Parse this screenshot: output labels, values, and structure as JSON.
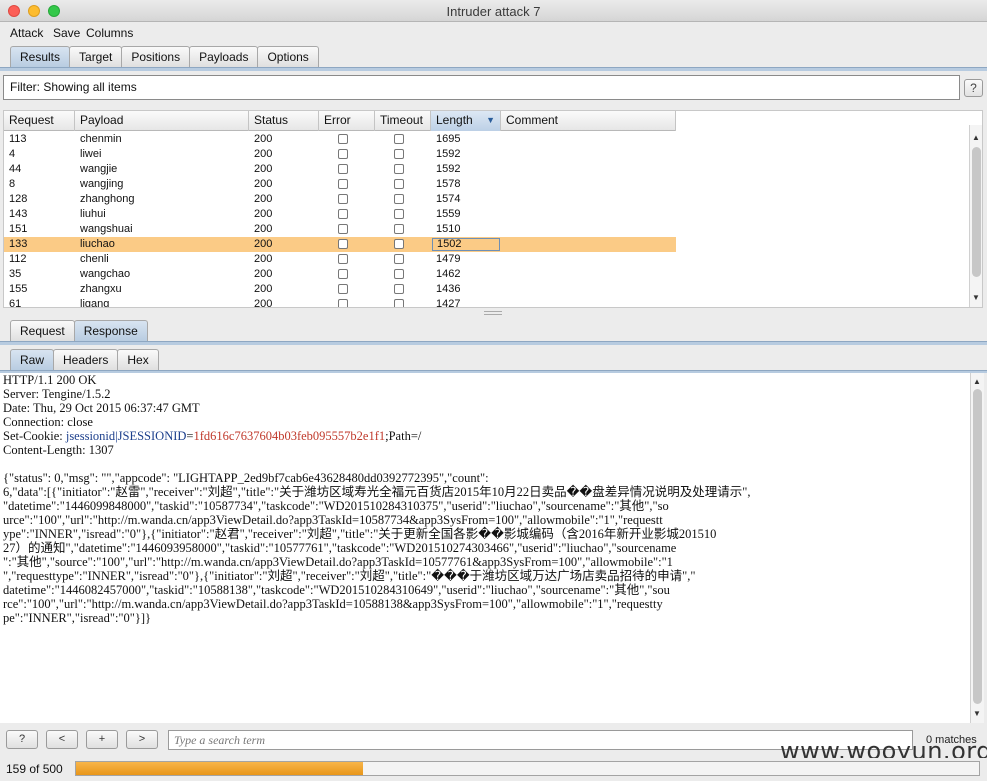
{
  "window": {
    "title": "Intruder attack 7"
  },
  "menu": [
    "Attack",
    "Save",
    "Columns"
  ],
  "main_tabs": [
    {
      "label": "Results",
      "active": true
    },
    {
      "label": "Target",
      "active": false
    },
    {
      "label": "Positions",
      "active": false
    },
    {
      "label": "Payloads",
      "active": false
    },
    {
      "label": "Options",
      "active": false
    }
  ],
  "filter": {
    "text": "Filter: Showing all items",
    "help": "?"
  },
  "results_table": {
    "columns": [
      "Request",
      "Payload",
      "Status",
      "Error",
      "Timeout",
      "Length",
      "Comment"
    ],
    "sorted_column": "Length",
    "rows": [
      {
        "request": "113",
        "payload": "chenmin",
        "status": "200",
        "error": false,
        "timeout": false,
        "length": "1695",
        "comment": ""
      },
      {
        "request": "4",
        "payload": "liwei",
        "status": "200",
        "error": false,
        "timeout": false,
        "length": "1592",
        "comment": ""
      },
      {
        "request": "44",
        "payload": "wangjie",
        "status": "200",
        "error": false,
        "timeout": false,
        "length": "1592",
        "comment": ""
      },
      {
        "request": "8",
        "payload": "wangjing",
        "status": "200",
        "error": false,
        "timeout": false,
        "length": "1578",
        "comment": ""
      },
      {
        "request": "128",
        "payload": "zhanghong",
        "status": "200",
        "error": false,
        "timeout": false,
        "length": "1574",
        "comment": ""
      },
      {
        "request": "143",
        "payload": "liuhui",
        "status": "200",
        "error": false,
        "timeout": false,
        "length": "1559",
        "comment": ""
      },
      {
        "request": "151",
        "payload": "wangshuai",
        "status": "200",
        "error": false,
        "timeout": false,
        "length": "1510",
        "comment": ""
      },
      {
        "request": "133",
        "payload": "liuchao",
        "status": "200",
        "error": false,
        "timeout": false,
        "length": "1502",
        "comment": "",
        "selected": true
      },
      {
        "request": "112",
        "payload": "chenli",
        "status": "200",
        "error": false,
        "timeout": false,
        "length": "1479",
        "comment": ""
      },
      {
        "request": "35",
        "payload": "wangchao",
        "status": "200",
        "error": false,
        "timeout": false,
        "length": "1462",
        "comment": ""
      },
      {
        "request": "155",
        "payload": "zhangxu",
        "status": "200",
        "error": false,
        "timeout": false,
        "length": "1436",
        "comment": ""
      },
      {
        "request": "61",
        "payload": "ligang",
        "status": "200",
        "error": false,
        "timeout": false,
        "length": "1427",
        "comment": ""
      }
    ]
  },
  "reqres_tabs": [
    {
      "label": "Request",
      "active": false
    },
    {
      "label": "Response",
      "active": true
    }
  ],
  "view_tabs": [
    {
      "label": "Raw",
      "active": true
    },
    {
      "label": "Headers",
      "active": false
    },
    {
      "label": "Hex",
      "active": false
    }
  ],
  "response": {
    "lines": [
      "HTTP/1.1 200 OK",
      "Server: Tengine/1.5.2",
      "Date: Thu, 29 Oct 2015 06:37:47 GMT",
      "Connection: close"
    ],
    "cookie_label": "Set-Cookie: ",
    "cookie_key": "jsessionid|JSESSIONID",
    "cookie_eq": "=",
    "cookie_value": "1fd616c7637604b03feb095557b2e1f1",
    "cookie_tail": ";Path=/",
    "content_length": "Content-Length: 1307",
    "body_lines": [
      "{\"status\": 0,\"msg\": \"\",\"appcode\": \"LIGHTAPP_2ed9bf7cab6e43628480dd0392772395\",\"count\":",
      "6,\"data\":[{\"initiator\":\"赵雷\",\"receiver\":\"刘超\",\"title\":\"关于潍坊区域寿光全福元百货店2015年10月22日卖品��盘差异情况说明及处理请示\",",
      "\"datetime\":\"1446099848000\",\"taskid\":\"10587734\",\"taskcode\":\"WD201510284310375\",\"userid\":\"liuchao\",\"sourcename\":\"其他\",\"so",
      "urce\":\"100\",\"url\":\"http://m.wanda.cn/app3ViewDetail.do?app3TaskId=10587734&app3SysFrom=100\",\"allowmobile\":\"1\",\"requestt",
      "ype\":\"INNER\",\"isread\":\"0\"},{\"initiator\":\"赵君\",\"receiver\":\"刘超\",\"title\":\"关于更新全国各影��影城编码（含2016年新开业影城201510",
      "27）的通知\",\"datetime\":\"1446093958000\",\"taskid\":\"10577761\",\"taskcode\":\"WD201510274303466\",\"userid\":\"liuchao\",\"sourcename",
      "\":\"其他\",\"source\":\"100\",\"url\":\"http://m.wanda.cn/app3ViewDetail.do?app3TaskId=10577761&app3SysFrom=100\",\"allowmobile\":\"1",
      "\",\"requesttype\":\"INNER\",\"isread\":\"0\"},{\"initiator\":\"刘超\",\"receiver\":\"刘超\",\"title\":\"���于潍坊区域万达广场店卖品招待的申请\",\"",
      "datetime\":\"1446082457000\",\"taskid\":\"10588138\",\"taskcode\":\"WD201510284310649\",\"userid\":\"liuchao\",\"sourcename\":\"其他\",\"sou",
      "rce\":\"100\",\"url\":\"http://m.wanda.cn/app3ViewDetail.do?app3TaskId=10588138&app3SysFrom=100\",\"allowmobile\":\"1\",\"requestty",
      "pe\":\"INNER\",\"isread\":\"0\"}]}"
    ]
  },
  "search": {
    "placeholder": "Type a search term",
    "matches": "0 matches",
    "buttons": [
      "?",
      "<",
      "+",
      ">"
    ]
  },
  "status": {
    "text": "159 of 500",
    "progress_fraction": 0.318
  },
  "watermark": "www.wooyun.org"
}
